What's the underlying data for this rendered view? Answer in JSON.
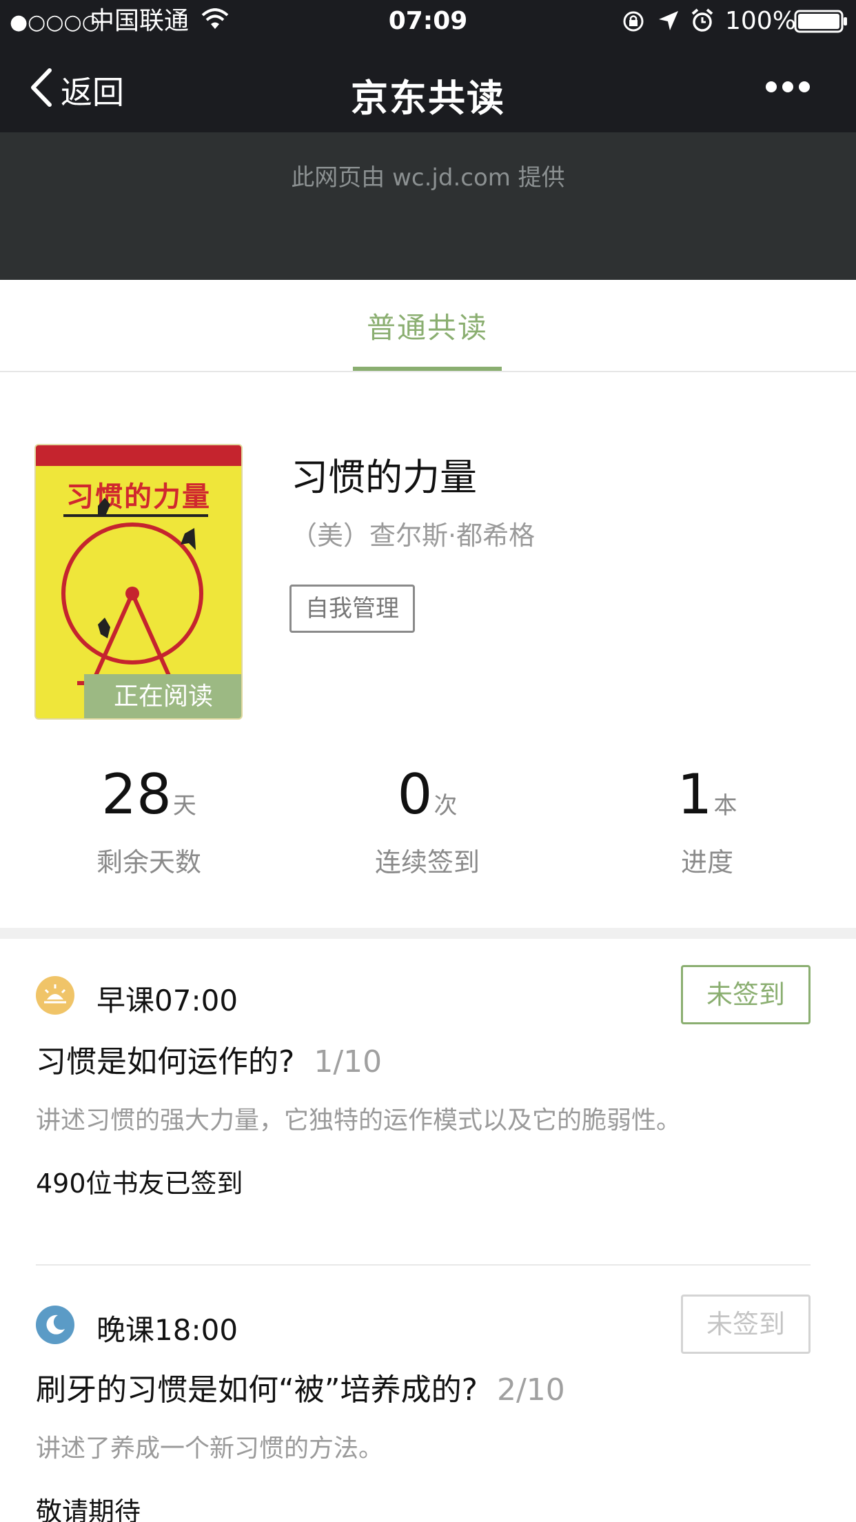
{
  "status_bar": {
    "signal": "●○○○○",
    "carrier": "中国联通",
    "time": "07:09",
    "battery": "100%",
    "icons": [
      "wifi-icon",
      "lock-rotation-icon",
      "location-icon",
      "alarm-icon",
      "battery-icon"
    ]
  },
  "nav": {
    "back_label": "返回",
    "title": "京东共读",
    "more_label": "•••"
  },
  "provider_text": "此网页由 wc.jd.com 提供",
  "tabs": [
    {
      "label": "普通共读",
      "active": true
    }
  ],
  "book": {
    "title": "习惯的力量",
    "author": "（美）查尔斯·都希格",
    "tag": "自我管理",
    "cover_title": "习惯的力量",
    "reading_badge": "正在阅读"
  },
  "stats": [
    {
      "value": "28",
      "unit": "天",
      "label": "剩余天数"
    },
    {
      "value": "0",
      "unit": "次",
      "label": "连续签到"
    },
    {
      "value": "1",
      "unit": "本",
      "label": "进度"
    }
  ],
  "lessons": [
    {
      "icon": "sunrise-icon",
      "name": "早课07:00",
      "button": "未签到",
      "button_active": true,
      "title": "习惯是如何运作的?",
      "progress": "1/10",
      "desc": "讲述习惯的强大力量，它独特的运作模式以及它的脆弱性。",
      "count": "490位书友已签到"
    },
    {
      "icon": "moon-icon",
      "name": "晚课18:00",
      "button": "未签到",
      "button_active": false,
      "title": "刷牙的习惯是如何“被”培养成的?",
      "progress": "2/10",
      "desc": "讲述了养成一个新习惯的方法。",
      "count": "敬请期待"
    }
  ],
  "colors": {
    "accent": "#8aae70",
    "topbar": "#1b1c20",
    "provider_bg": "#2e3132",
    "sunrise_icon": "#f0c468",
    "moon_icon": "#5b9bc6"
  }
}
